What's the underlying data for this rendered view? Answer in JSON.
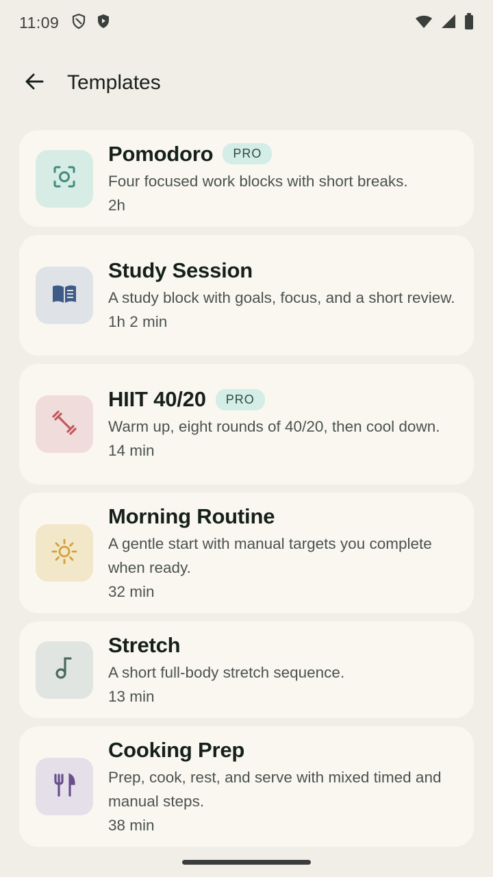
{
  "status_bar": {
    "time": "11:09",
    "left_icons": [
      "shield-outline-icon",
      "shield-filled-icon"
    ],
    "right_icons": [
      "wifi-icon",
      "cell-signal-icon",
      "battery-icon"
    ]
  },
  "app_bar": {
    "back_icon": "arrow-back-icon",
    "title": "Templates"
  },
  "templates": [
    {
      "id": "pomodoro",
      "title": "Pomodoro",
      "badge": "PRO",
      "description": "Four focused work blocks with short breaks.",
      "duration": "2h",
      "icon": "focus-target-icon",
      "tile_color": "#d6ece5",
      "icon_color": "#3f8b7c"
    },
    {
      "id": "study-session",
      "title": "Study Session",
      "badge": "",
      "description": "A study block with goals, focus, and a short review.",
      "duration": "1h 2 min",
      "icon": "book-icon",
      "tile_color": "#dfe2e7",
      "icon_color": "#3e5a86"
    },
    {
      "id": "hiit",
      "title": "HIIT 40/20",
      "badge": "PRO",
      "description": "Warm up, eight rounds of 40/20, then cool down.",
      "duration": "14 min",
      "icon": "dumbbell-icon",
      "tile_color": "#f1dcdc",
      "icon_color": "#c0585d"
    },
    {
      "id": "morning-routine",
      "title": "Morning Routine",
      "badge": "",
      "description": "A gentle start with manual targets you complete when ready.",
      "duration": "32 min",
      "icon": "sun-icon",
      "tile_color": "#f3e7c9",
      "icon_color": "#d2a03a"
    },
    {
      "id": "stretch",
      "title": "Stretch",
      "badge": "",
      "description": "A short full-body stretch sequence.",
      "duration": "13 min",
      "icon": "music-note-icon",
      "tile_color": "#e0e5e1",
      "icon_color": "#4c6a5f"
    },
    {
      "id": "cooking-prep",
      "title": "Cooking Prep",
      "badge": "",
      "description": "Prep, cook, rest, and serve with mixed timed and manual steps.",
      "duration": "38 min",
      "icon": "fork-knife-icon",
      "tile_color": "#e5dfe9",
      "icon_color": "#6a4f8c"
    }
  ]
}
